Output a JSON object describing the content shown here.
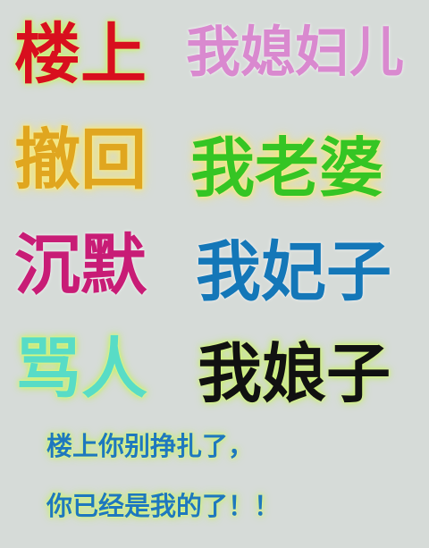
{
  "rows": [
    {
      "left": "楼上",
      "right": "我媳妇儿",
      "left_color": "#d80f1e",
      "right_color": "#d989cf"
    },
    {
      "left": "撤回",
      "right": "我老婆",
      "left_color": "#e0a61f",
      "right_color": "#35c524"
    },
    {
      "left": "沉默",
      "right": "我妃子",
      "left_color": "#c81c76",
      "right_color": "#1477b8"
    },
    {
      "left": "骂人",
      "right": "我娘子",
      "left_color": "#58dcc6",
      "right_color": "#111111"
    }
  ],
  "footer": {
    "line1": "楼上你别挣扎了，",
    "line2": "你已经是我的了！！",
    "color": "#1f78be"
  }
}
